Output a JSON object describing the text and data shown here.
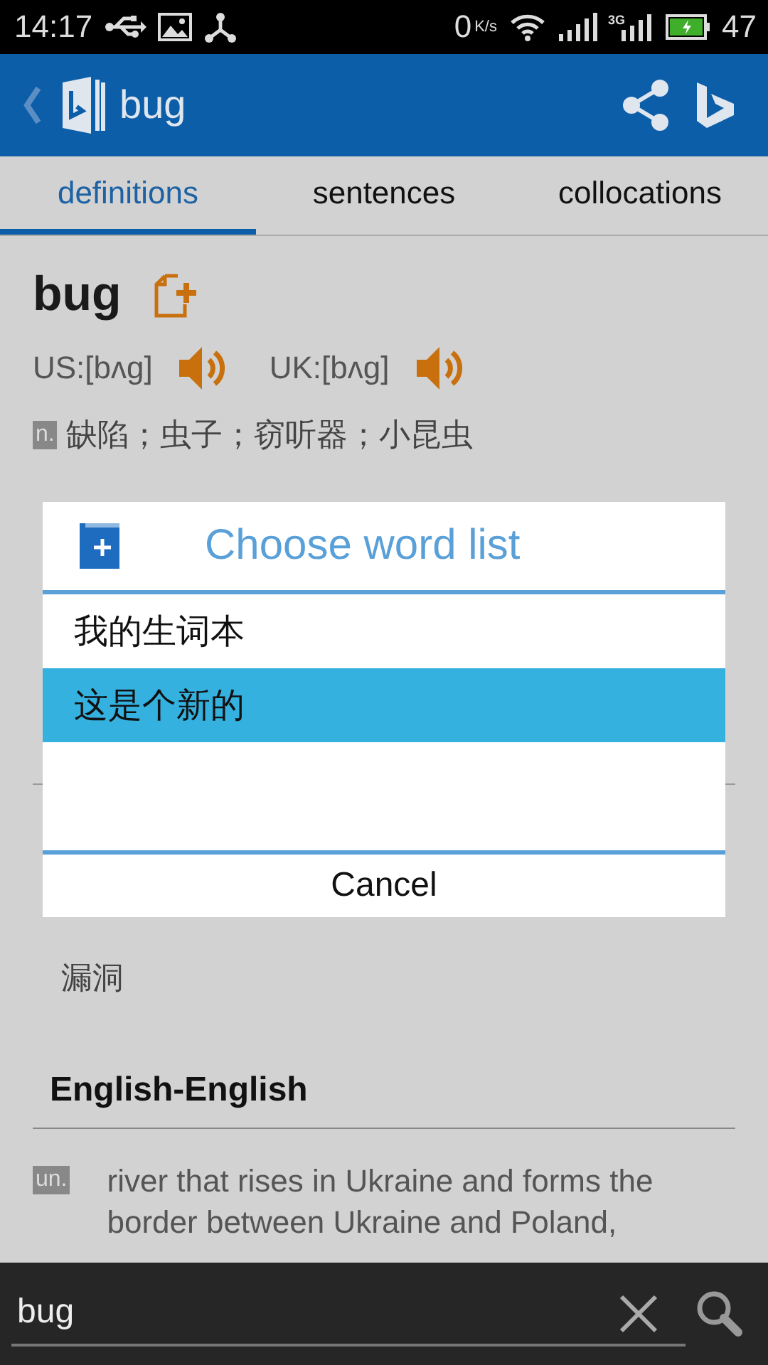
{
  "status_bar": {
    "time": "14:17",
    "speed": "0",
    "speed_unit": "K/s",
    "network": "3G",
    "battery": "47"
  },
  "app_bar": {
    "title": "bug"
  },
  "tabs": [
    {
      "label": "definitions",
      "selected": true
    },
    {
      "label": "sentences",
      "selected": false
    },
    {
      "label": "collocations",
      "selected": false
    }
  ],
  "entry": {
    "word": "bug",
    "pronunciations": [
      {
        "label": "US:[bʌg]"
      },
      {
        "label": "UK:[bʌg]"
      }
    ],
    "definitions": [
      {
        "pos": "n.",
        "text": "缺陷；虫子；窃听器；小昆虫"
      }
    ]
  },
  "translations": [
    "漏洞"
  ],
  "english_section": {
    "heading": "English-English",
    "definitions": [
      {
        "pos": "un.",
        "text": "river that rises in Ukraine and forms the border between Ukraine and Poland,"
      }
    ]
  },
  "dialog": {
    "title": "Choose word list",
    "items": [
      {
        "label": "我的生词本",
        "selected": false
      },
      {
        "label": "这是个新的",
        "selected": true
      }
    ],
    "cancel": "Cancel"
  },
  "search": {
    "value": "bug"
  }
}
